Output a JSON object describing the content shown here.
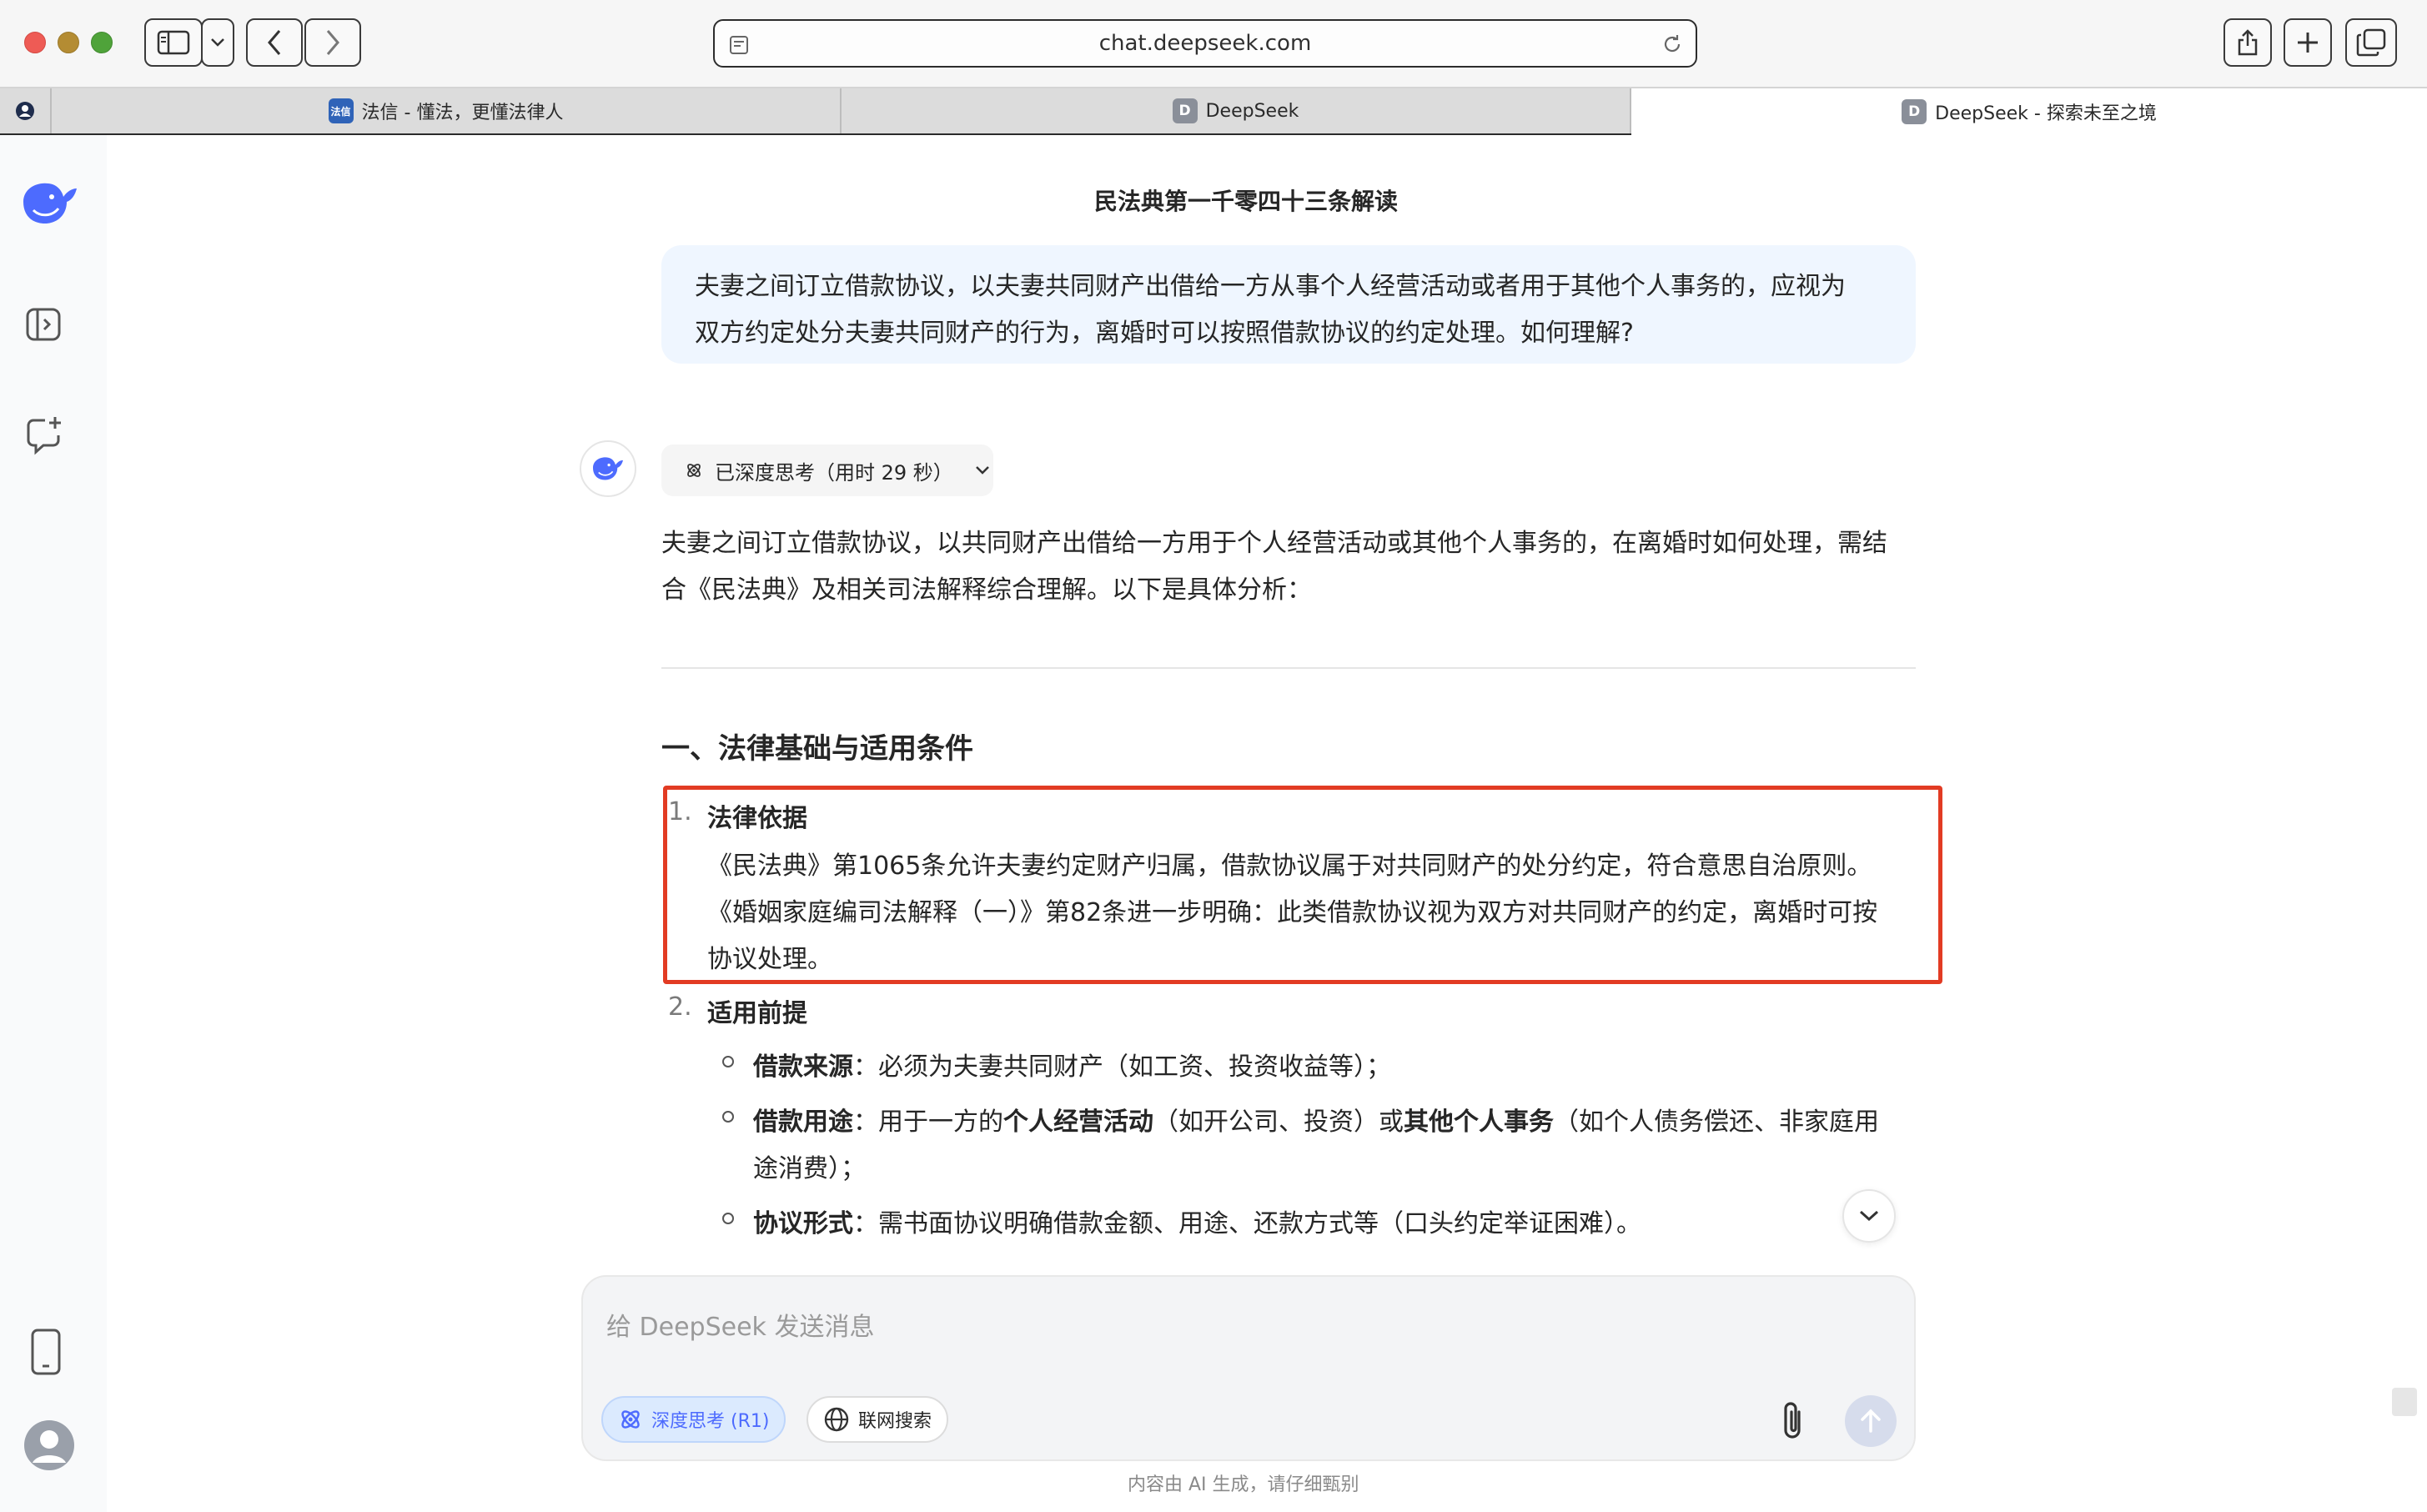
{
  "browser": {
    "url": "chat.deepseek.com",
    "tabs": [
      {
        "label": "法信 - 懂法，更懂法律人",
        "favicon": "法信"
      },
      {
        "label": "DeepSeek",
        "favicon": "D"
      },
      {
        "label": "DeepSeek - 探索未至之境",
        "favicon": "D",
        "active": true
      }
    ]
  },
  "rail": {
    "icons": [
      "deepseek-logo-icon",
      "sidebar-toggle-icon",
      "new-chat-icon",
      "mobile-icon",
      "user-avatar-icon"
    ]
  },
  "chat": {
    "title": "民法典第一千零四十三条解读",
    "user_message_line1": "夫妻之间订立借款协议，以夫妻共同财产出借给一方从事个人经营活动或者用于其他个人事务的，应视为",
    "user_message_line2": "双方约定处分夫妻共同财产的行为，离婚时可以按照借款协议的约定处理。如何理解?",
    "thinking_label": "已深度思考（用时 29 秒）",
    "intro_line1": "夫妻之间订立借款协议，以共同财产出借给一方用于个人经营活动或其他个人事务的，在离婚时如何处理，需结",
    "intro_line2": "合《民法典》及相关司法解释综合理解。以下是具体分析：",
    "section1_title": "一、法律基础与适用条件",
    "item1": {
      "number": "1.",
      "title": "法律依据",
      "line1": "《民法典》第1065条允许夫妻约定财产归属，借款协议属于对共同财产的处分约定，符合意思自治原则。",
      "line2": "《婚姻家庭编司法解释（一）》第82条进一步明确：此类借款协议视为双方对共同财产的约定，离婚时可按",
      "line3": "协议处理。"
    },
    "item2": {
      "number": "2.",
      "title": "适用前提",
      "bullet1_label": "借款来源",
      "bullet1_text": "：必须为夫妻共同财产（如工资、投资收益等）；",
      "bullet2_label": "借款用途",
      "bullet2_pre": "：用于一方的",
      "bullet2_bold1": "个人经营活动",
      "bullet2_mid": "（如开公司、投资）或",
      "bullet2_bold2": "其他个人事务",
      "bullet2_post": "（如个人债务偿还、非家庭用",
      "bullet2_line2": "途消费）；",
      "bullet3_label": "协议形式",
      "bullet3_text": "：需书面协议明确借款金额、用途、还款方式等（口头约定举证困难）。"
    }
  },
  "composer": {
    "placeholder": "给 DeepSeek 发送消息",
    "deep_think_label": "深度思考 (R1)",
    "web_search_label": "联网搜索",
    "footer_note": "内容由 AI 生成，请仔细甄别"
  },
  "colors": {
    "accent": "#4d6bfe",
    "highlight_border": "#e23b23",
    "user_bubble": "#eff6ff"
  }
}
